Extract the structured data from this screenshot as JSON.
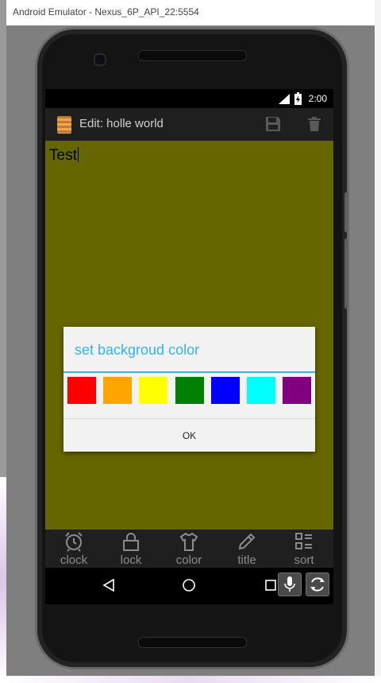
{
  "window": {
    "title": "Android Emulator - Nexus_6P_API_22:5554"
  },
  "status_bar": {
    "time": "2:00"
  },
  "action_bar": {
    "title": "Edit: holle world",
    "icons": [
      "notepad-icon",
      "save-icon",
      "delete-icon"
    ]
  },
  "note": {
    "text": "Test",
    "background_color": "#666600"
  },
  "dialog": {
    "title": "set backgroud color",
    "colors": [
      "#ff0000",
      "#ffa500",
      "#ffff00",
      "#008000",
      "#0000ff",
      "#00ffff",
      "#800080"
    ],
    "ok_label": "OK",
    "accent": "#33b5e5"
  },
  "bottom_menu": {
    "items": [
      {
        "label": "clock",
        "icon": "alarm-clock-icon"
      },
      {
        "label": "lock",
        "icon": "padlock-icon"
      },
      {
        "label": "color",
        "icon": "shirt-icon"
      },
      {
        "label": "title",
        "icon": "pencil-icon"
      },
      {
        "label": "sort",
        "icon": "list-icon"
      }
    ]
  },
  "nav_bar": {
    "icons": [
      "back-icon",
      "home-icon",
      "recents-icon"
    ]
  },
  "emulator_controls": {
    "icons": [
      "microphone-icon",
      "rotate-icon"
    ]
  }
}
